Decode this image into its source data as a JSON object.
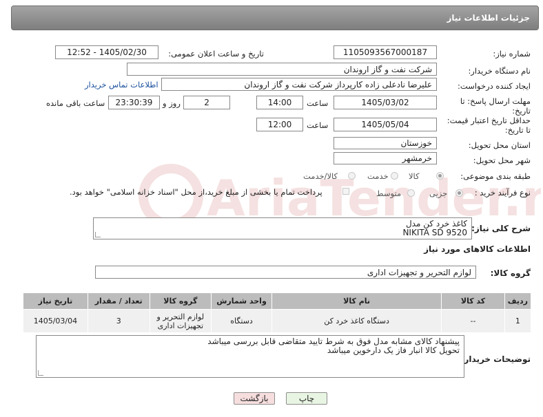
{
  "header": {
    "title": "جزئیات اطلاعات نیاز"
  },
  "form": {
    "need_number_label": "شماره نیاز:",
    "need_number": "1105093567000187",
    "announce_label": "تاریخ و ساعت اعلان عمومی:",
    "announce_value": "1405/02/30 - 12:52",
    "buyer_org_label": "نام دستگاه خریدار:",
    "buyer_org": "شرکت نفت و گاز اروندان",
    "requester_label": "ایجاد کننده درخواست:",
    "requester": "علیرضا نادعلی زاده کارپرداز شرکت نفت و گاز اروندان",
    "buyer_contact_link": "اطلاعات تماس خریدار",
    "reply_deadline_label_1": "مهلت ارسال پاسخ: تا",
    "reply_deadline_label_2": "تاریخ:",
    "reply_date": "1405/03/02",
    "time_label": "ساعت",
    "reply_time": "14:00",
    "days_value": "2",
    "days_label": "روز و",
    "remaining_time": "23:30:39",
    "remaining_label": "ساعت باقی مانده",
    "price_validity_label_1": "حداقل تاریخ اعتبار قیمت:",
    "price_validity_label_2": "تا تاریخ:",
    "price_date": "1405/05/04",
    "price_time": "12:00",
    "province_label": "استان محل تحویل:",
    "province": "خوزستان",
    "city_label": "شهر محل تحویل:",
    "city": "خرمشهر",
    "category_label": "طبقه بندی موضوعی:",
    "category_options": [
      "کالا",
      "خدمت",
      "کالا/خدمت"
    ],
    "process_label": "نوع فرآیند خرید :",
    "process_options": [
      "جزیی",
      "متوسط"
    ],
    "payment_note": "پرداخت تمام یا بخشی از مبلغ خرید،از محل \"اسناد خزانه اسلامی\" خواهد بود."
  },
  "description": {
    "label": "شرح کلی نیاز:",
    "line1": "کاغذ خرد کن  مدل",
    "line2": "NIKITA SD 9520"
  },
  "goods_section": {
    "title": "اطلاعات کالاهای مورد نیاز",
    "group_label": "گروه کالا:",
    "group_value": "لوازم التحریر و تجهیزات اداری"
  },
  "table": {
    "headers": [
      "ردیف",
      "کد کالا",
      "نام کالا",
      "واحد شمارش",
      "گروه کالا",
      "تعداد / مقدار",
      "تاریخ نیاز"
    ],
    "rows": [
      {
        "row": "1",
        "code": "--",
        "name": "دستگاه کاغذ خرد کن",
        "unit": "دستگاه",
        "group_line1": "لوازم التحریر و",
        "group_line2": "تجهیزات اداری",
        "qty": "3",
        "date": "1405/03/04"
      }
    ]
  },
  "buyer_notes": {
    "label": "توضیحات خریدار:",
    "line1": "پیشنهاد کالای مشابه مدل فوق به شرط تایید متقاضی قابل بررسی میباشد",
    "line2": "تحویل کالا انبار فاز یک دارخوین میباشد"
  },
  "buttons": {
    "print": "چاپ",
    "back": "بازگشت"
  },
  "watermark": {
    "text": "AriaTender.neT"
  },
  "colors": {
    "header": "#8e8e8e",
    "link": "#1a4f9c",
    "back_button": "#f7dede",
    "print_button": "#e9f5e3"
  }
}
